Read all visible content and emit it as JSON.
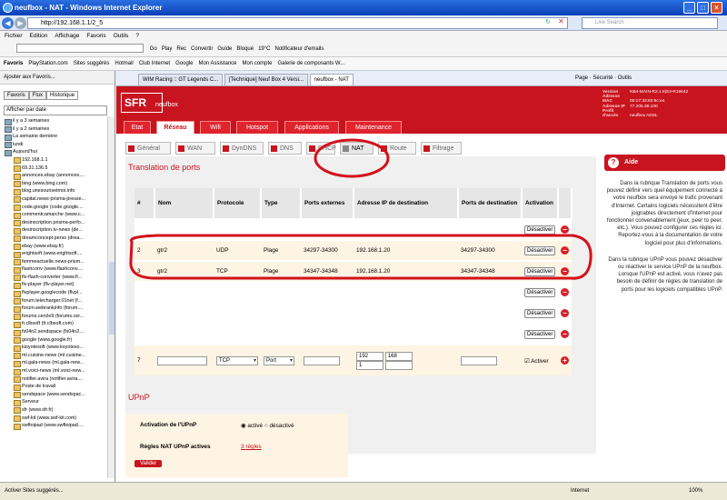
{
  "window": {
    "title": "neufbox - NAT - Windows Internet Explorer"
  },
  "address": {
    "url": "http://192.168.1.1/2_5",
    "search_placeholder": "Live Search"
  },
  "menu": [
    "Fichier",
    "Edition",
    "Affichage",
    "Favoris",
    "Outils",
    "?"
  ],
  "toolbar": [
    "Go",
    "Play",
    "Rec",
    "Convertir",
    "Guide",
    "Bloqué",
    "19°C",
    "Notificateur d'emails"
  ],
  "favbar": [
    "Favoris",
    "PlayStation.com",
    "Sites suggérés",
    "Hotmail",
    "Club Internet",
    "Google",
    "Mon Assistance",
    "Mon compte",
    "Galerie de composants W..."
  ],
  "sidebar": {
    "header": "Ajouter aux Favoris...",
    "tabs": [
      "Favoris",
      "Flux",
      "Historique"
    ],
    "filter": "Afficher par date",
    "history": [
      {
        "type": "group",
        "label": "il y a 3 semaines"
      },
      {
        "type": "group",
        "label": "il y a 2 semaines"
      },
      {
        "type": "group",
        "label": "La semaine dernière"
      },
      {
        "type": "group",
        "label": "lundi"
      },
      {
        "type": "group",
        "label": "Aujourd'hui"
      },
      {
        "type": "site",
        "label": "192.168.1.1"
      },
      {
        "type": "site",
        "label": "69.31.136.5"
      },
      {
        "type": "site",
        "label": "annonces.ebay (annonces...."
      },
      {
        "type": "site",
        "label": "bing (www.bing.com)"
      },
      {
        "type": "site",
        "label": "blog.unesourisetmoi.info"
      },
      {
        "type": "site",
        "label": "capital.news-prisma-presse..."
      },
      {
        "type": "site",
        "label": "code.google (code.google...."
      },
      {
        "type": "site",
        "label": "commentcamarche (www.c..."
      },
      {
        "type": "site",
        "label": "desinscription.prisma-perfo..."
      },
      {
        "type": "site",
        "label": "desinscription.tv-news (de..."
      },
      {
        "type": "site",
        "label": "dreamconcept.perso (drea..."
      },
      {
        "type": "site",
        "label": "ebay (www.ebay.fr)"
      },
      {
        "type": "site",
        "label": "erightsoft (www.erightsoft...."
      },
      {
        "type": "site",
        "label": "femmeactuelle.news-prism..."
      },
      {
        "type": "site",
        "label": "flashconv (www.flashconv...."
      },
      {
        "type": "site",
        "label": "flv-flash-converter (www.fl..."
      },
      {
        "type": "site",
        "label": "flv-player (flv-player.net)"
      },
      {
        "type": "site",
        "label": "flvplayer.googlecode (flvpl..."
      },
      {
        "type": "site",
        "label": "forum.telecharger.01net (f..."
      },
      {
        "type": "site",
        "label": "forum.webrankinfo (forum...."
      },
      {
        "type": "site",
        "label": "forums.cercle9 (forums.cer..."
      },
      {
        "type": "site",
        "label": "fr.clbsoft (fr.clbsoft.com)"
      },
      {
        "type": "site",
        "label": "fs04n2.sendspace (fs04n2...."
      },
      {
        "type": "site",
        "label": "google (www.google.fr)"
      },
      {
        "type": "site",
        "label": "kioyotesoft (www.koyoteso..."
      },
      {
        "type": "site",
        "label": "ml.cuisine-news (ml.cuisine..."
      },
      {
        "type": "site",
        "label": "ml.gala-news (ml.gala-new..."
      },
      {
        "type": "site",
        "label": "ml.voici-news (ml.voici-new..."
      },
      {
        "type": "site",
        "label": "notifier.avira (notifier.avira...."
      },
      {
        "type": "site",
        "label": "Poste de travail"
      },
      {
        "type": "site",
        "label": "sendspace (www.sendspac..."
      },
      {
        "type": "site",
        "label": "Serveur"
      },
      {
        "type": "site",
        "label": "sfr (www.sfr.fr)"
      },
      {
        "type": "site",
        "label": "swf-kit (www.swf-kit.com)"
      },
      {
        "type": "site",
        "label": "swftoipad (www.swftoipad...."
      }
    ],
    "footer": "Activer Sites suggérés..."
  },
  "tabs": [
    "WIM Racing :: GT Legends C...",
    "[Technique] Neuf Box 4 Versi...",
    "neufbox - NAT"
  ],
  "tools_right": [
    "Page",
    "Sécurité",
    "Outils"
  ],
  "router": {
    "brand": "SFR",
    "product": "neufbox",
    "info": [
      {
        "k": "Version",
        "v": "NB4-MAIN-R2.1.8|S3-R15542"
      },
      {
        "k": "Adresse MAC",
        "v": "00:17:33:93:9c:e4"
      },
      {
        "k": "Adresse IP",
        "v": "77.205.38.100"
      },
      {
        "k": "Profil d'accès",
        "v": "neufbox ADSL"
      }
    ],
    "main_nav": [
      "Etat",
      "Réseau",
      "Wifi",
      "Hotspot",
      "Applications",
      "Maintenance"
    ],
    "sub_nav": [
      "Général",
      "WAN",
      "DynDNS",
      "DNS",
      "DHCP",
      "NAT",
      "Route",
      "Filtrage"
    ],
    "section_title": "Translation de ports",
    "columns": [
      "#",
      "Nom",
      "Protocole",
      "Type",
      "Ports externes",
      "Adresse IP de destination",
      "Ports de destination",
      "Activation"
    ],
    "disable_label": "Désactiver",
    "rules": [
      {
        "n": "2",
        "name": "gtr2",
        "proto": "UDP",
        "type": "Plage",
        "ext": "34297-34300",
        "ip": "192.168.1.20",
        "dst": "34297-34300"
      },
      {
        "n": "3",
        "name": "gtr2",
        "proto": "TCP",
        "type": "Plage",
        "ext": "34347-34348",
        "ip": "192.168.1.20",
        "dst": "34347-34348"
      }
    ],
    "new_rule": {
      "n": "7",
      "proto": "TCP",
      "type": "Port",
      "ip1": "192",
      "ip2": "168",
      "ip3": "1",
      "activate": "Activer"
    },
    "upnp_title": "UPnP",
    "upnp_label": "Activation de l'UPnP",
    "upnp_on": "activé",
    "upnp_off": "désactivé",
    "upnp_rules_label": "Règles NAT UPnP actives",
    "upnp_rules_value": "3 règles",
    "validate": "Valider",
    "help_title": "Aide",
    "help_text": "Dans la rubrique Translation de ports vous pouvez définir vers quel équipement connecté à votre neufbox sera envoyé le trafic provenant d'Internet. Certains logiciels nécessitent d'être joignables directement d'Internet pour fonctionner convenablement (jeux, peer to peer, etc.). Vous pouvez configurer ces règles ici. Reportez-vous à la documentation de votre logiciel pour plus d'informations.",
    "help_text2": "Dans la rubrique UPnP vous pouvez désactiver ou réactiver le service UPnP de la neufbox. Lorsque l'UPnP est activé, vous n'avez pas besoin de définir de règles de translation de ports pour les logiciels compatibles UPnP."
  },
  "status": {
    "zone": "Internet",
    "zoom": "100%"
  }
}
